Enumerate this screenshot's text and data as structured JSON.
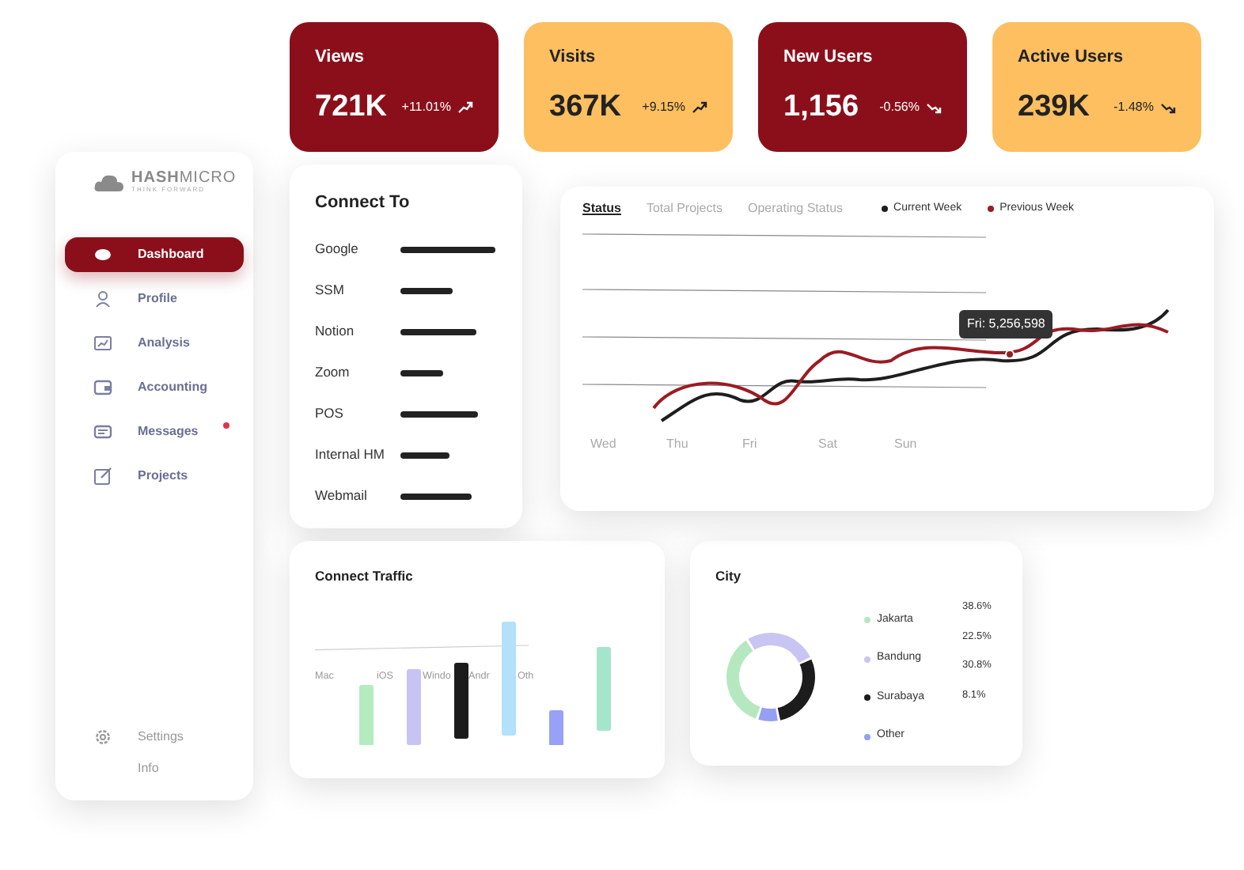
{
  "sidebar": {
    "logo": {
      "name": "**HASH**MICRO",
      "tagline": "THINK FORWARD"
    },
    "items": [
      {
        "label": "Dashboard",
        "selected": true,
        "unread": false
      },
      {
        "label": "Profile",
        "selected": false,
        "unread": false
      },
      {
        "label": "Analysis",
        "selected": false,
        "unread": false
      },
      {
        "label": "Accounting",
        "selected": false,
        "unread": false
      },
      {
        "label": "Messages",
        "selected": false,
        "unread": true
      },
      {
        "label": "Projects",
        "selected": false,
        "unread": false
      }
    ],
    "footer": [
      {
        "label": "Settings"
      },
      {
        "label": "Info"
      }
    ]
  },
  "stats": [
    {
      "title": "Views",
      "value": "721K",
      "change": "+11.01%",
      "kind": "up",
      "color": "#8b0f1a"
    },
    {
      "title": "Visits",
      "value": "367K",
      "change": "+9.15%",
      "kind": "up",
      "color": "#fdbf60"
    },
    {
      "title": "New Users",
      "value": "1,156",
      "change": "-0.56%",
      "kind": "down",
      "color": "#8b0f1a"
    },
    {
      "title": "Active Users",
      "value": "239K",
      "change": "-1.48%",
      "kind": "down",
      "color": "#fdbf60"
    }
  ],
  "connect_to": {
    "title": "Connect To",
    "rows": [
      {
        "label": "Google"
      },
      {
        "label": "SSM"
      },
      {
        "label": "Notion"
      },
      {
        "label": "Zoom"
      },
      {
        "label": "POS"
      },
      {
        "label": "Internal HM"
      },
      {
        "label": "Webmail"
      }
    ]
  },
  "status_chart": {
    "tabs": [
      {
        "label": "Status",
        "selected": true
      },
      {
        "label": "Total Projects",
        "selected": false
      },
      {
        "label": "Operating Status",
        "selected": false
      }
    ],
    "legend": [
      {
        "label": "Current Week",
        "color": "#1e1e1e"
      },
      {
        "label": "Previous Week",
        "color": "#9b1c24"
      }
    ],
    "days": [
      "Wed",
      "Thu",
      "Fri",
      "Sat",
      "Sun"
    ],
    "tooltip": "Fri: 5,256,598"
  },
  "traffic": {
    "title": "Connect Traffic",
    "labels": [
      "Mac",
      "iOS",
      "Windo",
      "Andr",
      "Oth"
    ],
    "bars": [
      {
        "color": "#b4ecc0"
      },
      {
        "color": "#c8c3f5"
      },
      {
        "color": "#1c1c1c"
      },
      {
        "color": "#b3e0fb"
      },
      {
        "color": "#97a1f5"
      },
      {
        "color": "#a5e5cb"
      }
    ]
  },
  "city": {
    "title": "City",
    "legend": [
      {
        "label": "Jakarta",
        "color": "#b6e8bf"
      },
      {
        "label": "Bandung",
        "color": "#c9c5f3"
      },
      {
        "label": "Surabaya",
        "color": "#1c1c1c"
      },
      {
        "label": "Other",
        "color": "#96a0f2"
      }
    ],
    "percentages": [
      "38.6%",
      "22.5%",
      "30.8%",
      "8.1%"
    ]
  }
}
